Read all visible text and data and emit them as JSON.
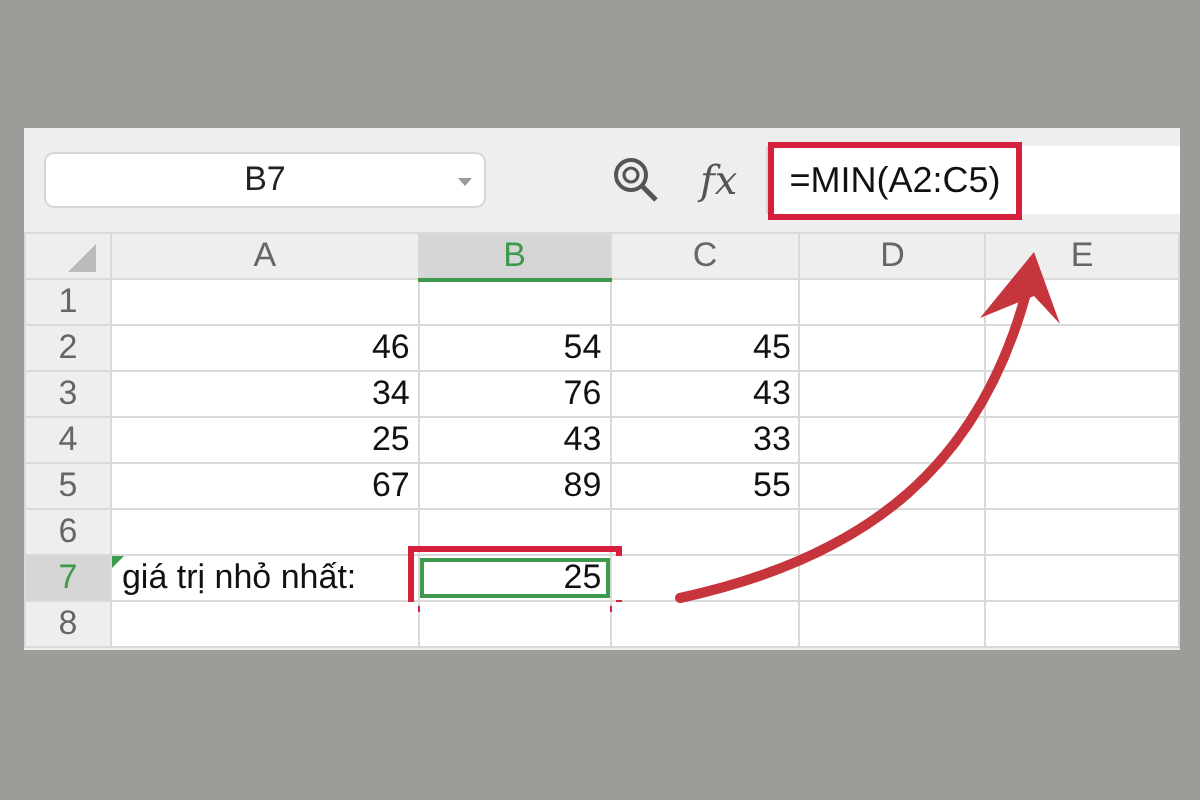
{
  "formula_bar": {
    "name_box": "B7",
    "formula": "=MIN(A2:C5)",
    "highlighted": true,
    "function_label": "fx"
  },
  "columns": [
    {
      "label": "A",
      "selected": false
    },
    {
      "label": "B",
      "selected": true
    },
    {
      "label": "C",
      "selected": false
    },
    {
      "label": "D",
      "selected": false
    },
    {
      "label": "E",
      "selected": false
    }
  ],
  "rows": [
    {
      "label": "1",
      "selected": false,
      "cells": [
        {},
        {},
        {},
        {},
        {}
      ]
    },
    {
      "label": "2",
      "selected": false,
      "cells": [
        {
          "text": "46"
        },
        {
          "text": "54"
        },
        {
          "text": "45"
        },
        {},
        {}
      ]
    },
    {
      "label": "3",
      "selected": false,
      "cells": [
        {
          "text": "34"
        },
        {
          "text": "76"
        },
        {
          "text": "43"
        },
        {},
        {}
      ]
    },
    {
      "label": "4",
      "selected": false,
      "cells": [
        {
          "text": "25"
        },
        {
          "text": "43"
        },
        {
          "text": "33"
        },
        {},
        {}
      ]
    },
    {
      "label": "5",
      "selected": false,
      "cells": [
        {
          "text": "67"
        },
        {
          "text": "89"
        },
        {
          "text": "55"
        },
        {},
        {}
      ]
    },
    {
      "label": "6",
      "selected": false,
      "cells": [
        {},
        {},
        {},
        {},
        {}
      ]
    },
    {
      "label": "7",
      "selected": true,
      "cells": [
        {
          "text": "giá trị nhỏ nhất:",
          "kind": "label",
          "flagged": true
        },
        {
          "text": "25",
          "selected": true,
          "highlighted": true
        },
        {},
        {},
        {}
      ]
    },
    {
      "label": "8",
      "selected": false,
      "cells": [
        {},
        {},
        {},
        {},
        {}
      ]
    }
  ],
  "annotation_arrow": true
}
